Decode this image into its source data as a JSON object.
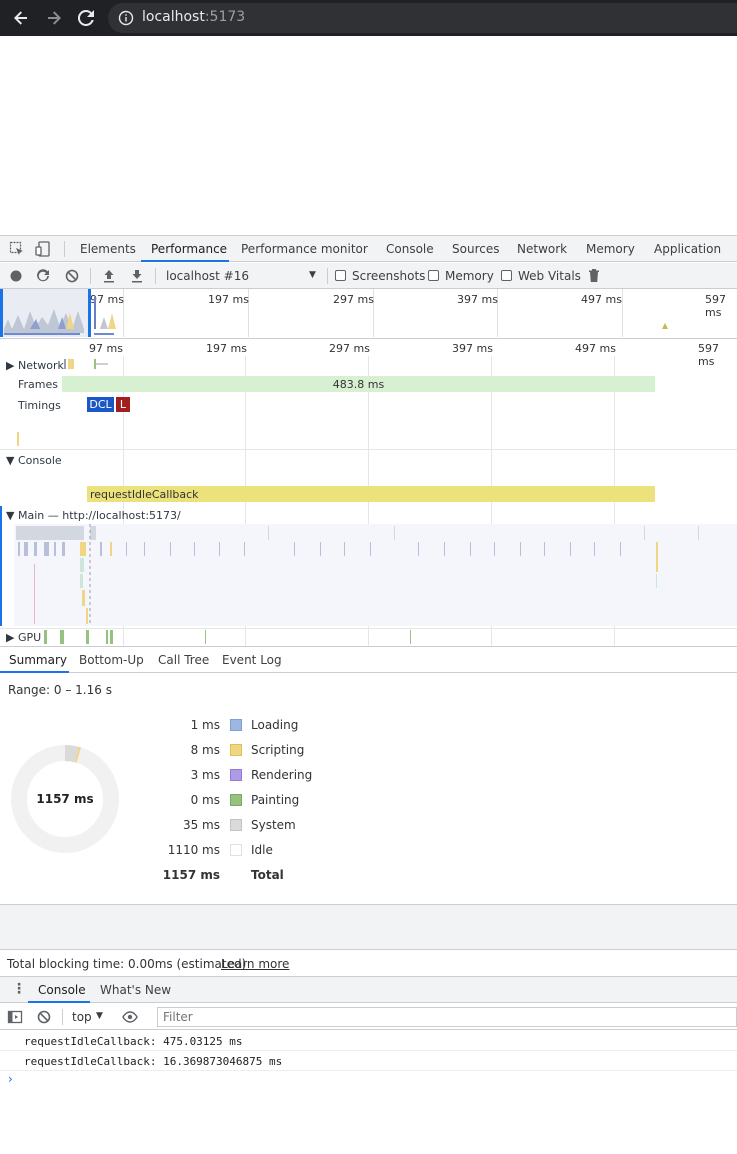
{
  "browser": {
    "url_host": "localhost",
    "url_port": ":5173"
  },
  "devtools": {
    "tabs": [
      "Elements",
      "Performance",
      "Performance monitor",
      "Console",
      "Sources",
      "Network",
      "Memory",
      "Application"
    ],
    "active_tab": "Performance"
  },
  "perf_toolbar": {
    "profile": "localhost #16",
    "checkboxes": [
      "Screenshots",
      "Memory",
      "Web Vitals"
    ]
  },
  "overview": {
    "ticks": [
      "97 ms",
      "197 ms",
      "297 ms",
      "397 ms",
      "497 ms",
      "597 ms"
    ]
  },
  "flamechart": {
    "ticks": [
      "97 ms",
      "197 ms",
      "297 ms",
      "397 ms",
      "497 ms",
      "597 ms"
    ],
    "tracks": {
      "network": "Network",
      "frames": "Frames",
      "timings": "Timings",
      "console": "Console",
      "main": "Main — http://localhost:5173/",
      "gpu": "GPU"
    },
    "frames_value": "483.8 ms",
    "markers": {
      "dcl": "DCL",
      "load": "L"
    },
    "console_event": "requestIdleCallback"
  },
  "bottom_tabs": [
    "Summary",
    "Bottom-Up",
    "Call Tree",
    "Event Log"
  ],
  "summary": {
    "range": "Range: 0 – 1.16 s",
    "donut_total": "1157 ms",
    "legend": [
      {
        "value": "1 ms",
        "name": "Loading",
        "color": "#9db7e3"
      },
      {
        "value": "8 ms",
        "name": "Scripting",
        "color": "#f0d684"
      },
      {
        "value": "3 ms",
        "name": "Rendering",
        "color": "#af9ae6"
      },
      {
        "value": "0 ms",
        "name": "Painting",
        "color": "#95c281"
      },
      {
        "value": "35 ms",
        "name": "System",
        "color": "#dadada"
      },
      {
        "value": "1110 ms",
        "name": "Idle",
        "color": "#ffffff"
      }
    ],
    "total_value": "1157 ms",
    "total_label": "Total"
  },
  "tbt": {
    "text": "Total blocking time: 0.00ms (estimated)",
    "link": "Learn more"
  },
  "drawer": {
    "tabs": [
      "Console",
      "What's New"
    ],
    "context": "top",
    "filter_placeholder": "Filter",
    "logs": [
      "requestIdleCallback: 475.03125 ms",
      "requestIdleCallback: 16.369873046875 ms"
    ],
    "prompt": "›"
  }
}
